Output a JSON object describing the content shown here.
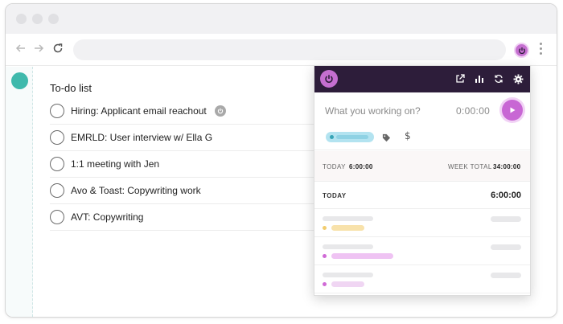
{
  "browser": {
    "window_controls": [
      "close",
      "minimize",
      "maximize"
    ],
    "nav_icons": [
      "back-arrow-icon",
      "forward-arrow-icon",
      "reload-icon"
    ],
    "address_value": "",
    "extension_icon": "power-icon",
    "menu_icon": "kebab-menu-icon"
  },
  "colors": {
    "accent": "#c56fd0",
    "header_dark": "#2d1d3a",
    "avatar": "#3fb9ac",
    "project_blue": "#36a4b6",
    "tag_yellow": "#f5d98a",
    "tag_pink": "#d06ad6"
  },
  "todo": {
    "title": "To-do list",
    "items": [
      {
        "label": "Hiring: Applicant email reachout",
        "has_timer": true
      },
      {
        "label": "EMRLD: User interview w/ Ella G",
        "has_timer": false
      },
      {
        "label": "1:1 meeting with Jen",
        "has_timer": false
      },
      {
        "label": "Avo & Toast: Copywriting work",
        "has_timer": false
      },
      {
        "label": "AVT: Copywriting",
        "has_timer": false
      }
    ]
  },
  "popup": {
    "header_icons": [
      "open-external-icon",
      "reports-icon",
      "sync-icon",
      "settings-icon"
    ],
    "timer": {
      "placeholder": "What you working on?",
      "value": "0:00:00"
    },
    "tag_icons": [
      "project-pill",
      "tag-icon",
      "dollar-icon"
    ],
    "summary": {
      "today_label": "TODAY",
      "today_value": "6:00:00",
      "week_label": "WEEK TOTAL",
      "week_value": "34:00:00"
    },
    "day": {
      "label": "TODAY",
      "value": "6:00:00"
    },
    "entries": [
      {
        "color": "yellow"
      },
      {
        "color": "pink"
      },
      {
        "color": "light-pink"
      }
    ]
  }
}
